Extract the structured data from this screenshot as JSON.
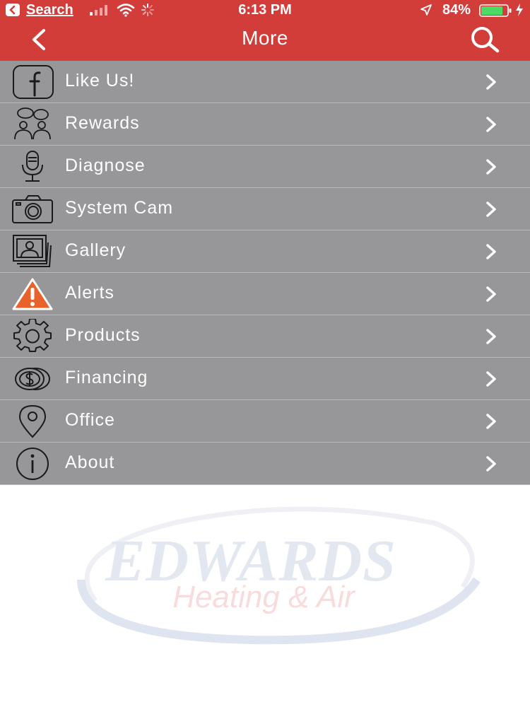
{
  "status_bar": {
    "back_label": "Search",
    "time": "6:13 PM",
    "battery_percent": "84%",
    "battery_level": 0.84,
    "icons": [
      "back-arrow-icon",
      "signal-bars-icon",
      "wifi-icon",
      "loading-spinner-icon",
      "location-arrow-icon",
      "battery-icon",
      "charging-bolt-icon"
    ]
  },
  "nav": {
    "title": "More",
    "back_icon": "back-chevron-icon",
    "search_icon": "search-icon"
  },
  "menu": {
    "items": [
      {
        "label": "Like Us!",
        "icon": "facebook-icon"
      },
      {
        "label": "Rewards",
        "icon": "people-group-icon"
      },
      {
        "label": "Diagnose",
        "icon": "microphone-icon"
      },
      {
        "label": "System Cam",
        "icon": "camera-icon"
      },
      {
        "label": "Gallery",
        "icon": "photo-gallery-icon"
      },
      {
        "label": "Alerts",
        "icon": "warning-triangle-icon"
      },
      {
        "label": "Products",
        "icon": "gear-icon"
      },
      {
        "label": "Financing",
        "icon": "coins-icon"
      },
      {
        "label": "Office",
        "icon": "map-pin-icon"
      },
      {
        "label": "About",
        "icon": "info-icon"
      }
    ],
    "chevron_icon": "chevron-right-icon"
  },
  "watermark": {
    "brand": "EDWARDS",
    "subtitle": "Heating & Air"
  },
  "colors": {
    "header": "#d23d39",
    "menu_background": "#979799",
    "menu_divider": "#b9b9bb",
    "alert_orange": "#e8622c",
    "battery_green": "#4cd964"
  }
}
